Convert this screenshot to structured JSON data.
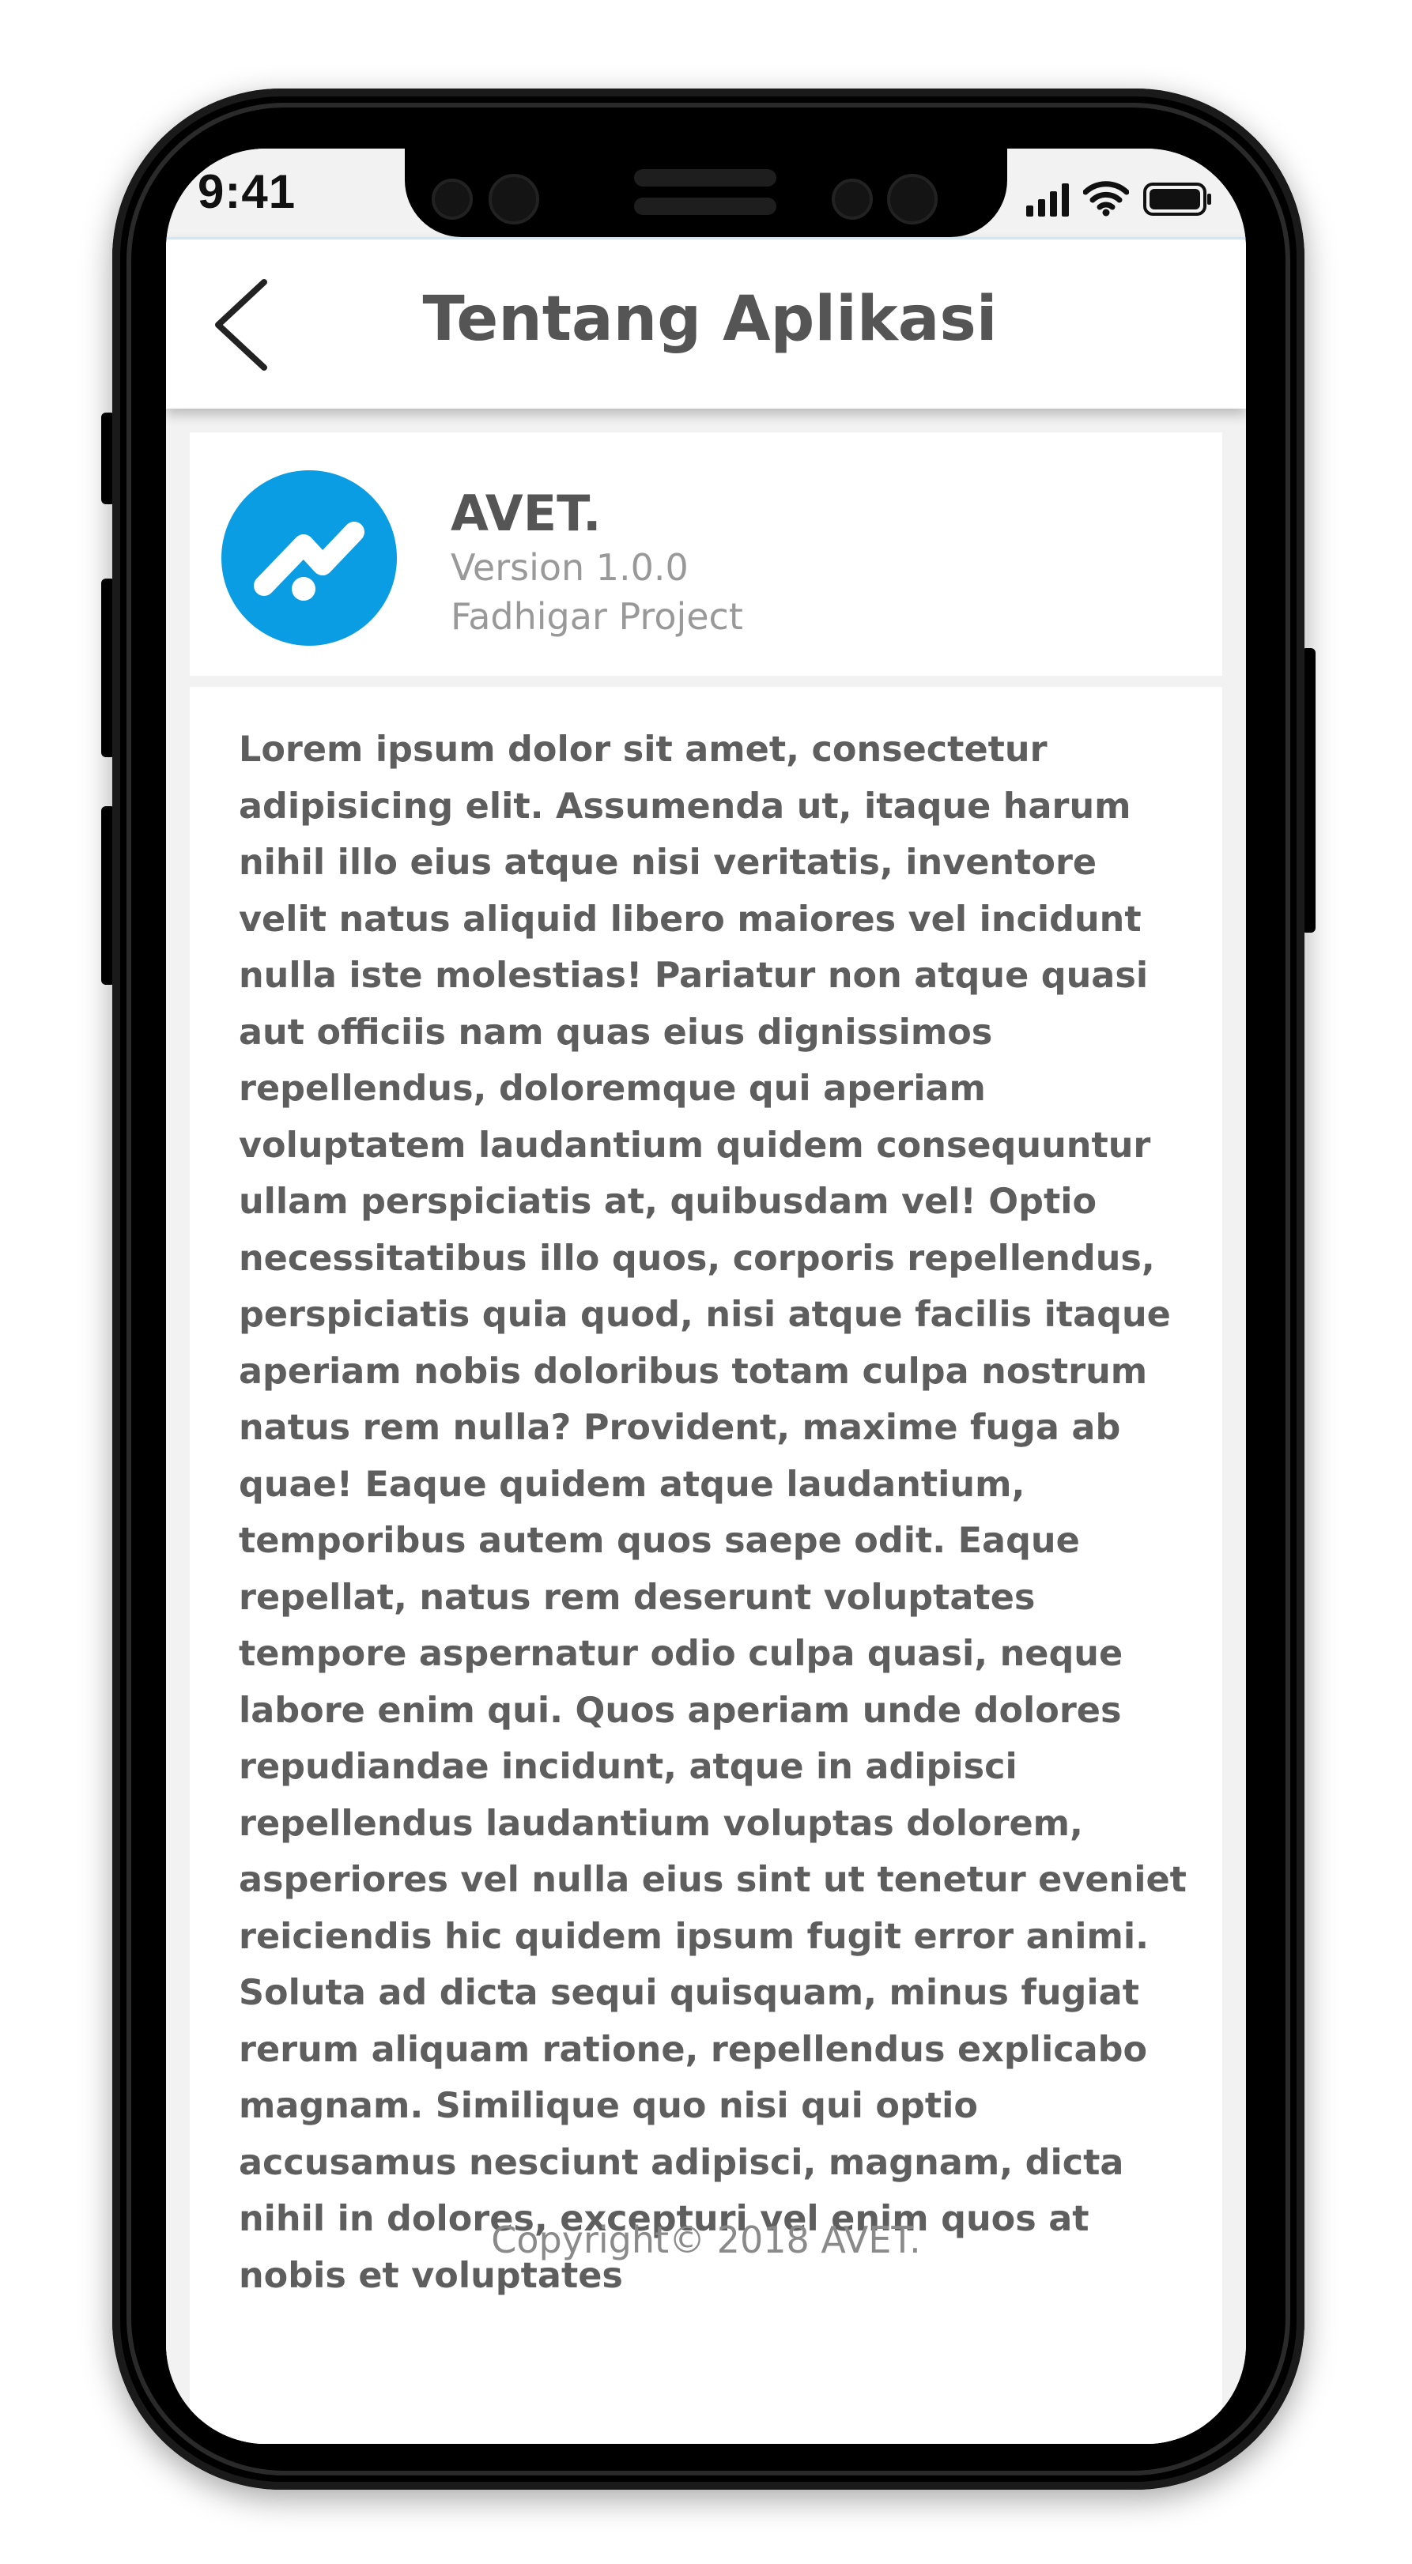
{
  "status_bar": {
    "time": "9:41",
    "icons": [
      "signal-icon",
      "wifi-icon",
      "battery-icon"
    ]
  },
  "header": {
    "back_icon": "chevron-left-icon",
    "title": "Tentang Aplikasi"
  },
  "app_info": {
    "logo_icon": "avet-logo-icon",
    "name": "AVET.",
    "version": "Version 1.0.0",
    "developer": "Fadhigar Project"
  },
  "description": {
    "text": "Lorem ipsum dolor sit amet, consectetur adipisicing elit. Assumenda ut, itaque harum nihil illo eius atque nisi veritatis, inventore velit natus aliquid libero maiores vel incidunt nulla iste molestias! Pariatur non atque quasi aut officiis nam quas eius dignissimos repellendus, doloremque qui aperiam voluptatem laudantium quidem consequuntur ullam perspiciatis at, quibusdam vel! Optio necessitatibus illo quos, corporis repellendus, perspiciatis quia quod, nisi atque facilis itaque aperiam nobis doloribus totam culpa nostrum natus rem nulla? Provident, maxime fuga ab quae! Eaque quidem atque laudantium, temporibus autem quos saepe odit. Eaque repellat, natus rem deserunt voluptates tempore aspernatur odio culpa quasi, neque labore enim qui. Quos aperiam unde dolores repudiandae incidunt, atque in adipisci repellendus laudantium voluptas dolorem, asperiores vel nulla eius sint ut tenetur eveniet reiciendis hic quidem ipsum fugit error animi. Soluta ad dicta sequi quisquam, minus fugiat rerum aliquam ratione, repellendus explicabo magnam. Similique quo nisi qui optio accusamus nesciunt adipisci, magnam, dicta nihil in dolores, excepturi vel enim quos at nobis et voluptates"
  },
  "footer": {
    "copyright": "Copyright© 2018 AVET."
  },
  "colors": {
    "brand": "#0b9de3",
    "title_text": "#555555",
    "muted_text": "#999999",
    "body_text": "#5e5e5e",
    "background": "#f2f2f2"
  }
}
